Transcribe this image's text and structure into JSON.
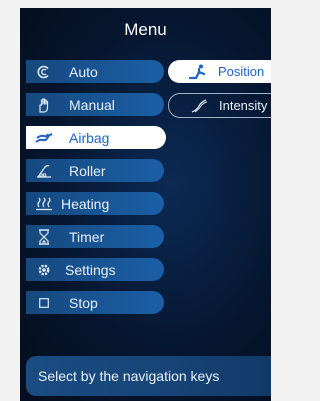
{
  "menu": {
    "title": "Menu"
  },
  "items": [
    {
      "key": "auto",
      "label": "Auto",
      "icon": "auto-icon",
      "active": false
    },
    {
      "key": "manual",
      "label": "Manual",
      "icon": "hand-icon",
      "active": false
    },
    {
      "key": "airbag",
      "label": "Airbag",
      "icon": "airbag-icon",
      "active": true
    },
    {
      "key": "roller",
      "label": "Roller",
      "icon": "roller-icon",
      "active": false
    },
    {
      "key": "heating",
      "label": "Heating",
      "icon": "heating-icon",
      "active": false
    },
    {
      "key": "timer",
      "label": "Timer",
      "icon": "timer-icon",
      "active": false
    },
    {
      "key": "settings",
      "label": "Settings",
      "icon": "gear-icon",
      "active": false
    },
    {
      "key": "stop",
      "label": "Stop",
      "icon": "stop-icon",
      "active": false
    }
  ],
  "submenu": [
    {
      "label": "Position",
      "icon": "position-icon",
      "selected": true
    },
    {
      "label": "Intensity",
      "icon": "intensity-icon",
      "selected": false
    }
  ],
  "hint": {
    "text": "Select by the navigation keys"
  },
  "colors": {
    "accent": "#1f62c2",
    "item_bg": "#1b5fa6",
    "screen_bg": "#06162f"
  }
}
